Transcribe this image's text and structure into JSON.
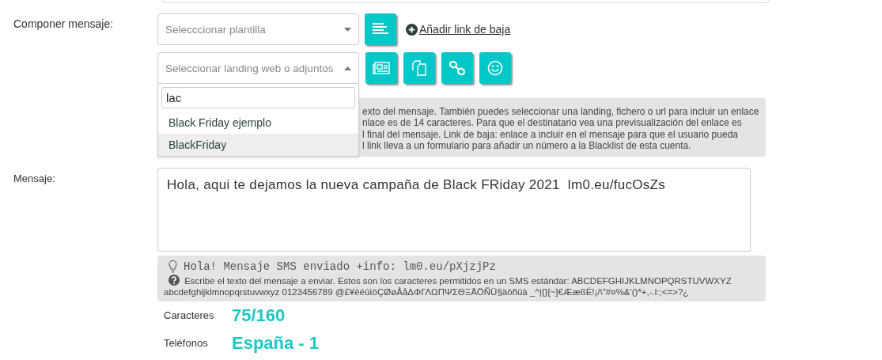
{
  "compose": {
    "label": "Componer mensaje:",
    "template_select": {
      "placeholder": "Selecccionar plantilla"
    },
    "unsubscribe_link": "Añadir link de baja",
    "landing_select": {
      "placeholder": "Seleccionar landing web o adjuntos",
      "expanded": true,
      "search": "lac",
      "options": [
        {
          "label": "Black Friday ejemplo",
          "selected": false
        },
        {
          "label": "BlackFriday",
          "selected": true
        }
      ]
    },
    "help_lines": [
      "exto del mensaje. También puedes seleccionar una landing, fichero o url para incluir un enlace",
      "nlace es de 14 caracteres. Para que el destinatario vea una previsualización del enlace es",
      "l final del mensaje. Link de baja: enlace a incluir en el mensaje para que el usuario pueda",
      "l link lleva a un formulario para añadir un número a la Blacklist de esta cuenta."
    ]
  },
  "message": {
    "label": "Mensaje:",
    "text": "Hola, aqui te dejamos la nueva campaña de Black FRiday 2021  lm0.eu/fucOsZs",
    "preview": "Hola! Mensaje SMS enviado +info: lm0.eu/pXjzjPz",
    "info": "Escribe el texto del mensaje a enviar. Estos son los caracteres permitidos en un SMS estándar: ABCDEFGHIJKLMNOPQRSTUVWXYZ abcdefghijklmnopqrstuvwxyz 0123456789 @£¥èéùìòÇØøÅåΔΦΓΛΩΠΨΣΘΞÄÖÑÜ§äöñüà _^|{}[~]€ÆæßÉ!¡/\\\"#¤%&'()*+,-.l:;<=>?¿"
  },
  "stats": [
    {
      "label": "Caracteres",
      "value": "75/160"
    },
    {
      "label": "Teléfonos",
      "value": "España - 1"
    }
  ]
}
